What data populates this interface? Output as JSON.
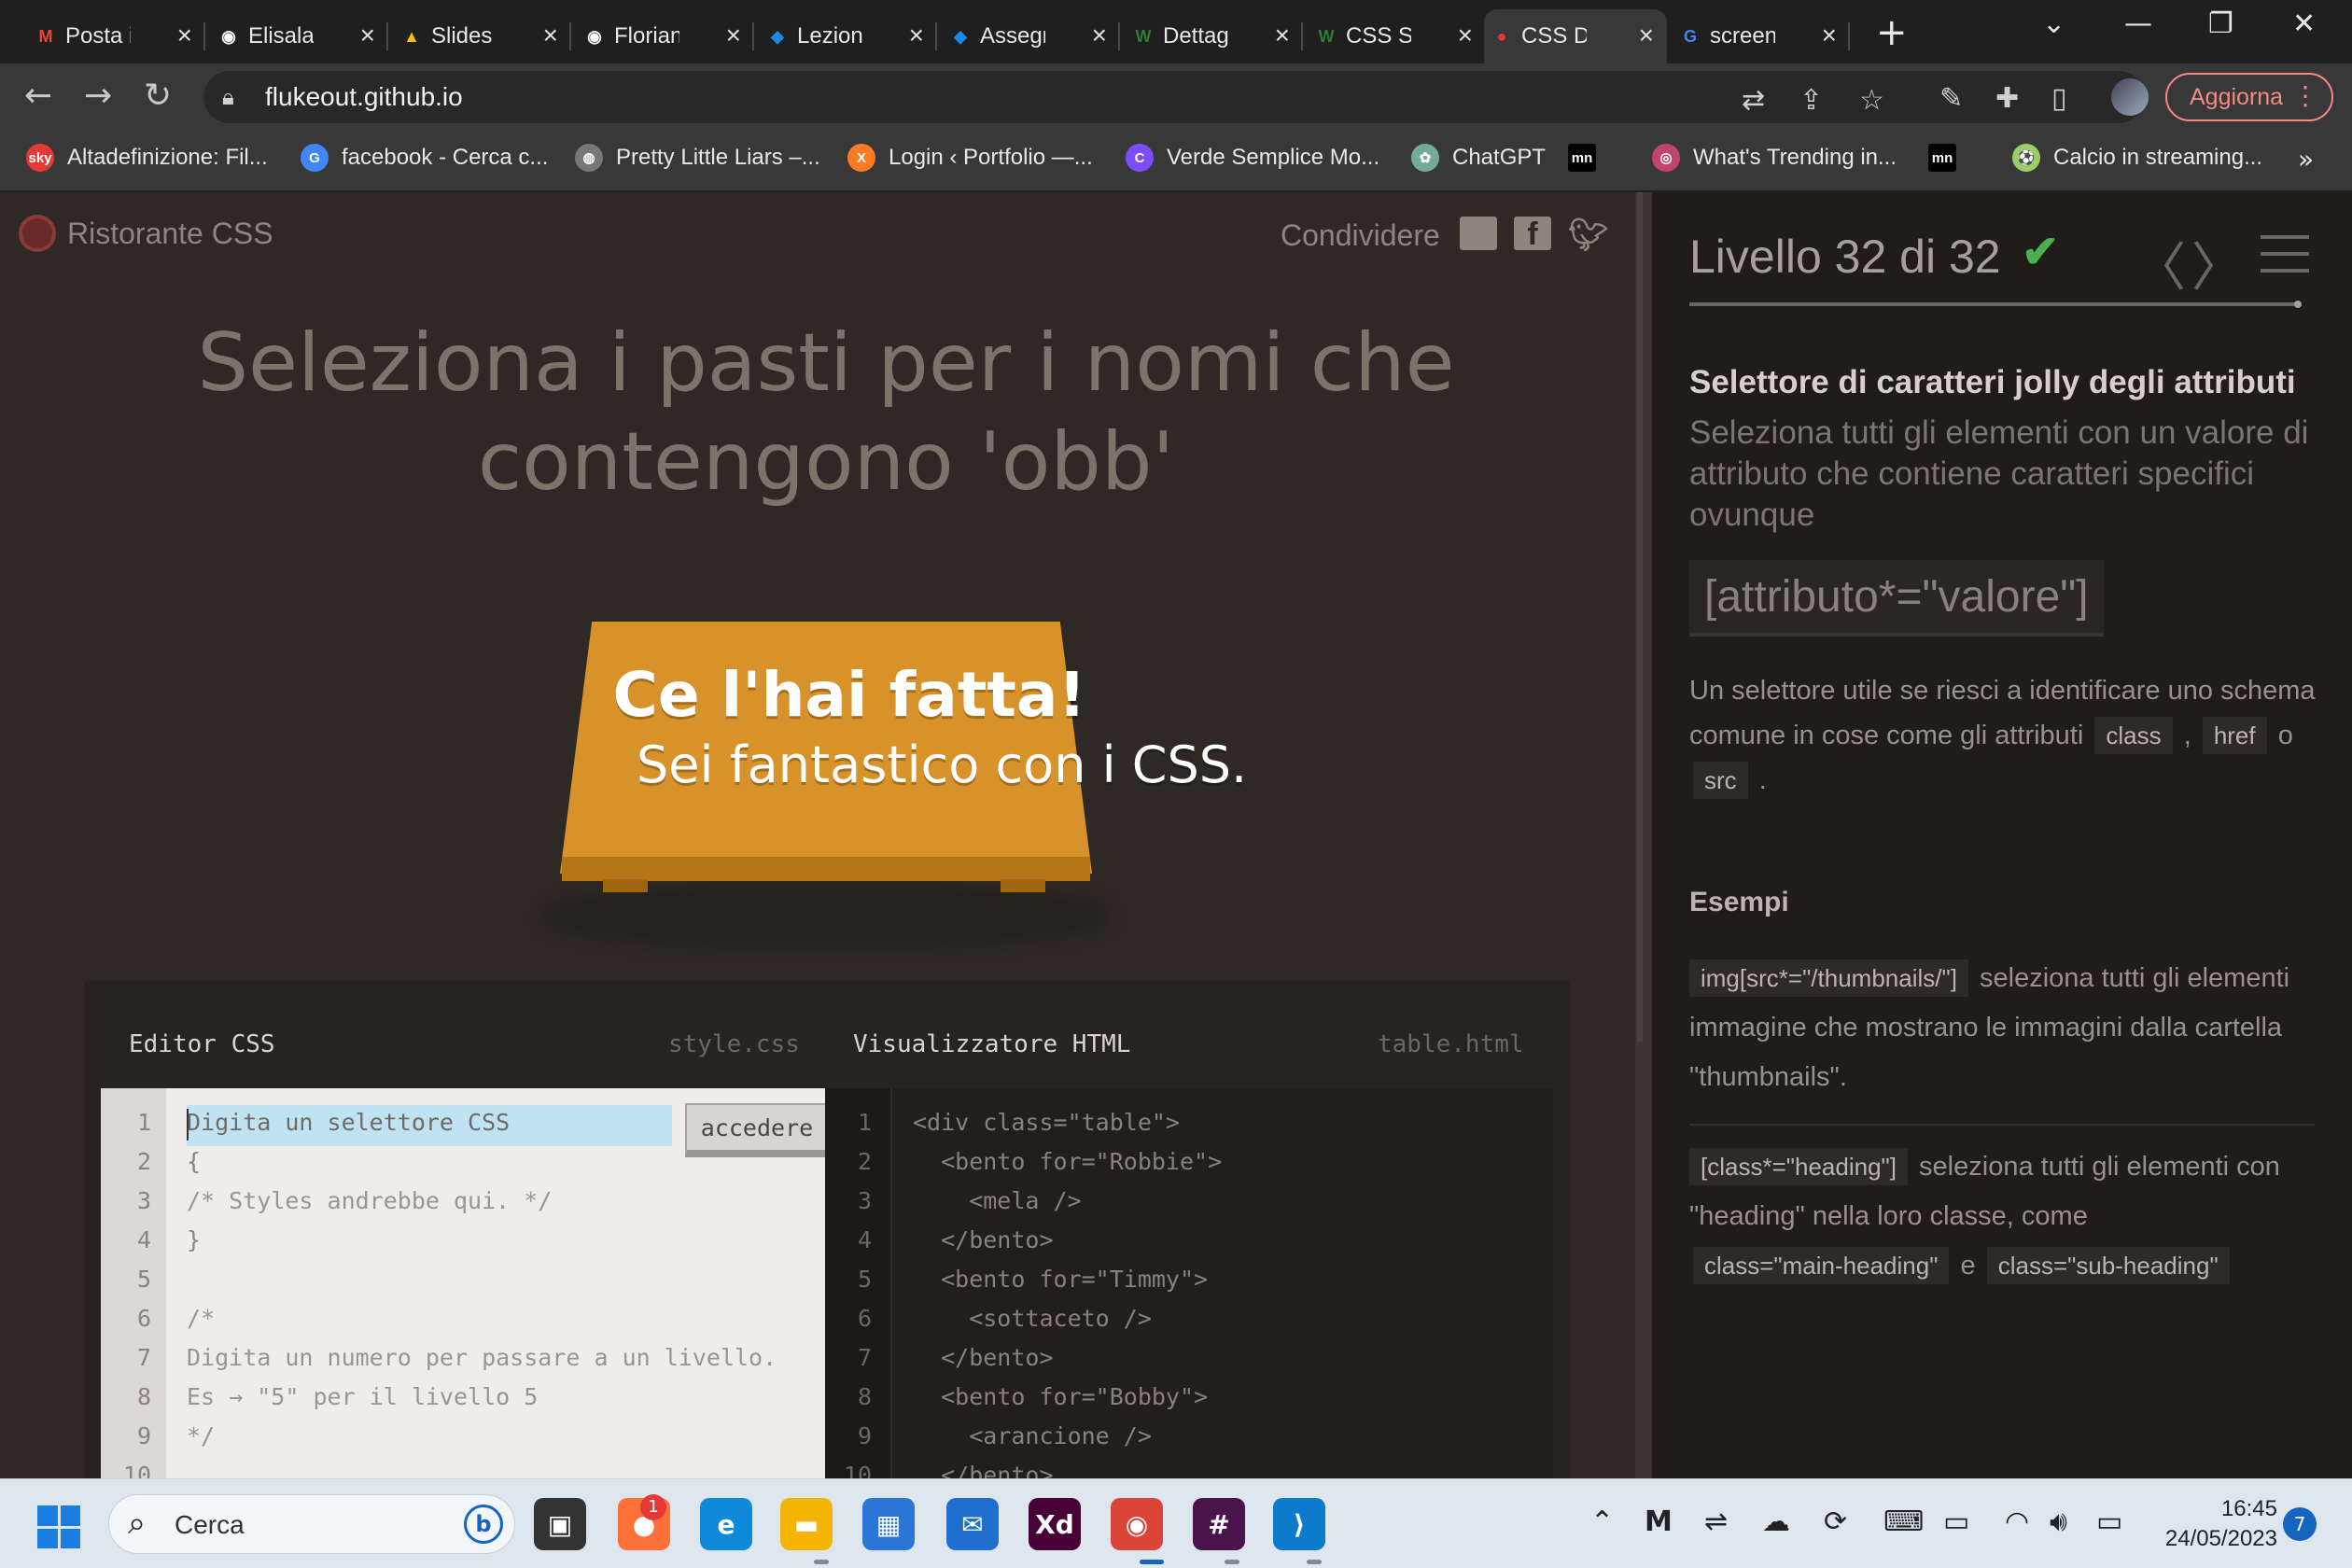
{
  "browser": {
    "tabs": [
      {
        "title": "Posta in arrivo",
        "icon": "gmail-icon",
        "color": "#ea4335",
        "glyph": "M"
      },
      {
        "title": "Elisalan",
        "icon": "github-icon",
        "color": "#ffffff",
        "glyph": "◉"
      },
      {
        "title": "Slides",
        "icon": "google-drive-icon",
        "color": "#fbbc04",
        "glyph": "▲"
      },
      {
        "title": "Florian",
        "icon": "github-icon",
        "color": "#ffffff",
        "glyph": "◉"
      },
      {
        "title": "Lezioni",
        "icon": "diamond-icon",
        "color": "#1e88e5",
        "glyph": "◆"
      },
      {
        "title": "Assegni",
        "icon": "diamond-icon",
        "color": "#1e88e5",
        "glyph": "◆"
      },
      {
        "title": "Dettagli",
        "icon": "w-icon",
        "color": "#2e7d32",
        "glyph": "W"
      },
      {
        "title": "CSS Selectors",
        "icon": "w-icon",
        "color": "#2e7d32",
        "glyph": "W"
      },
      {
        "title": "CSS Diner",
        "icon": "css-diner-icon",
        "color": "#e53935",
        "glyph": "●"
      },
      {
        "title": "screenshot",
        "icon": "google-icon",
        "color": "#4285f4",
        "glyph": "G"
      }
    ],
    "url": "flukeout.github.io",
    "update_label": "Aggiorna",
    "bookmarks": [
      {
        "label": "Altadefinizione: Fil...",
        "icon": "sky-icon",
        "color": "#e53935",
        "glyph": "sky"
      },
      {
        "label": "facebook - Cerca c...",
        "icon": "google-icon",
        "color": "#4285f4",
        "glyph": "G"
      },
      {
        "label": "Pretty Little Liars –...",
        "icon": "globe-icon",
        "color": "#777777",
        "glyph": "◍"
      },
      {
        "label": "Login ‹ Portfolio —...",
        "icon": "xampp-icon",
        "color": "#fb7a24",
        "glyph": "X"
      },
      {
        "label": "Verde Semplice Mo...",
        "icon": "canva-icon",
        "color": "#7c4dff",
        "glyph": "C"
      },
      {
        "label": "ChatGPT",
        "icon": "chatgpt-icon",
        "color": "#74aa9c",
        "glyph": "✿"
      },
      {
        "label": "",
        "icon": "mn-icon",
        "color": "#000000",
        "glyph": "mn"
      },
      {
        "label": "What's Trending in...",
        "icon": "dribbble-icon",
        "color": "#c0446e",
        "glyph": "◎"
      },
      {
        "label": "",
        "icon": "mn-icon",
        "color": "#000000",
        "glyph": "mn"
      },
      {
        "label": "Calcio in streaming...",
        "icon": "soccer-icon",
        "color": "#9ccc65",
        "glyph": "⚽"
      }
    ]
  },
  "game": {
    "brand": "Ristorante CSS",
    "share_label": "Condividere",
    "order_line1": "Seleziona i pasti per i nomi che",
    "order_line2": "contengono 'obb'",
    "win_title": "Ce l'hai fatta!",
    "win_subtitle": "Sei fantastico con i CSS.",
    "css_editor": {
      "title": "Editor CSS",
      "file": "style.css",
      "placeholder": "Digita un selettore CSS",
      "enter_label": "accedere",
      "lines": [
        "",
        "{",
        "/* Styles andrebbe qui. */",
        "}",
        "",
        "/*",
        "Digita un numero per passare a un livello.",
        "Es → \"5\" per il livello 5",
        "*/",
        ""
      ]
    },
    "html_viewer": {
      "title": "Visualizzatore HTML",
      "file": "table.html",
      "lines": [
        "<div class=\"table\">",
        "  <bento for=\"Robbie\">",
        "    <mela />",
        "  </bento>",
        "  <bento for=\"Timmy\">",
        "    <sottaceto />",
        "  </bento>",
        "  <bento for=\"Bobby\">",
        "    <arancione />",
        "  </bento>"
      ]
    }
  },
  "sidebar": {
    "level_text": "Livello 32 di 32",
    "progress": 1.0,
    "title": "Selettore di caratteri jolly degli attributi",
    "subtitle": "Seleziona tutti gli elementi con un valore di attributo che contiene caratteri specifici ovunque",
    "syntax": "[attributo*=\"valore\"]",
    "hint_text": "Un selettore utile se riesci a identificare uno schema comune in cose come gli attributi",
    "hint_pill1": "class",
    "hint_comma": ",",
    "hint_pill2": "href",
    "hint_or": "o",
    "hint_pill3": "src",
    "hint_end": ".",
    "examples_heading": "Esempi",
    "example1_code": "img[src*=\"/thumbnails/\"]",
    "example1_text": "seleziona tutti gli elementi immagine che mostrano le immagini dalla cartella \"thumbnails\".",
    "example2_code": "[class*=\"heading\"]",
    "example2_text": "seleziona tutti gli elementi con \"heading\" nella loro classe, come",
    "example2_pill1": "class=\"main-heading\"",
    "example2_and": "e",
    "example2_pill2": "class=\"sub-heading\""
  },
  "taskbar": {
    "search_placeholder": "Cerca",
    "time": "16:45",
    "date": "24/05/2023",
    "notification_count": "7",
    "badge_count": "1",
    "apps": [
      {
        "name": "task-view-icon",
        "color": "#333333",
        "glyph": "▣"
      },
      {
        "name": "firefox-icon",
        "color": "#ff7139",
        "glyph": "●"
      },
      {
        "name": "edge-icon",
        "color": "#0c8ad8",
        "glyph": "e"
      },
      {
        "name": "file-explorer-icon",
        "color": "#f4b400",
        "glyph": "▬"
      },
      {
        "name": "microsoft-store-icon",
        "color": "#2b74d8",
        "glyph": "▦"
      },
      {
        "name": "mail-icon",
        "color": "#1f6fd0",
        "glyph": "✉"
      },
      {
        "name": "adobe-xd-icon",
        "color": "#470137",
        "glyph": "Xd"
      },
      {
        "name": "chrome-icon",
        "color": "#db4437",
        "glyph": "◉"
      },
      {
        "name": "slack-icon",
        "color": "#4a154b",
        "glyph": "#"
      },
      {
        "name": "vscode-icon",
        "color": "#0e7acc",
        "glyph": "⟩"
      }
    ]
  }
}
